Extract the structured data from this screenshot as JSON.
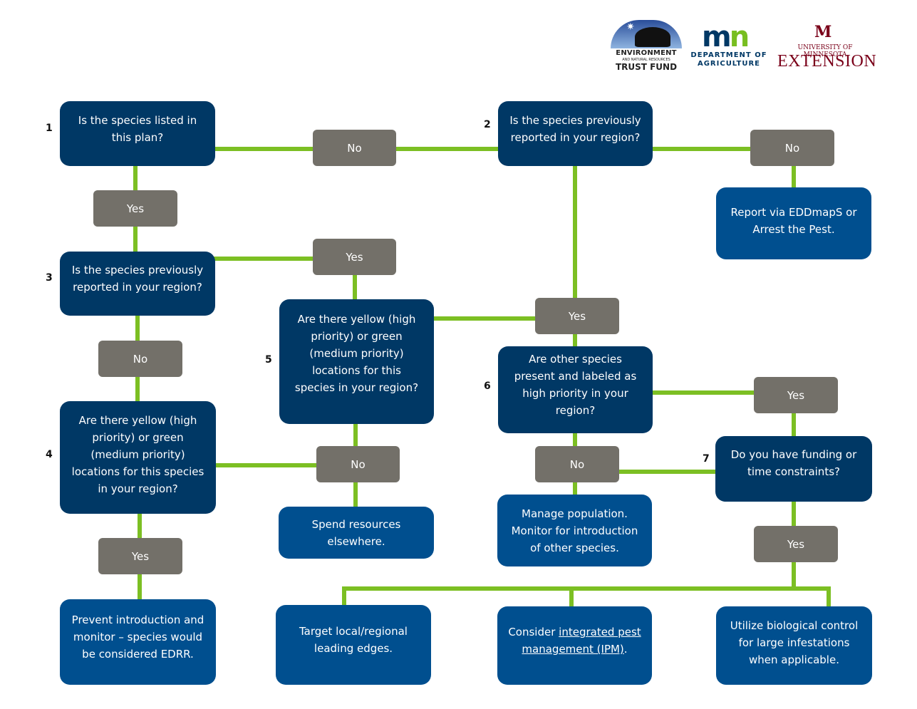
{
  "logos": {
    "trust_fund": {
      "line1": "ENVIRONMENT",
      "line2": "AND NATURAL RESOURCES",
      "line3": "TRUST FUND"
    },
    "mda": {
      "mark_m": "m",
      "mark_n": "n",
      "line1": "DEPARTMENT OF",
      "line2": "AGRICULTURE"
    },
    "umn": {
      "mark": "M",
      "line1": "UNIVERSITY OF MINNESOTA",
      "line2": "EXTENSION"
    }
  },
  "colors": {
    "question_box": "#003865",
    "action_box": "#004f8f",
    "answer_label": "#737069",
    "connector": "#7cbf23"
  },
  "steps": [
    {
      "number": "1",
      "text": "Is the species listed in this plan?"
    },
    {
      "number": "2",
      "text": "Is the species previously reported in your region?"
    },
    {
      "number": "3",
      "text": "Is the species previously reported in your region?"
    },
    {
      "number": "4",
      "text": "Are there yellow (high priority) or green (medium priority) locations for this species in your region?"
    },
    {
      "number": "5",
      "text": "Are there yellow (high priority) or green (medium priority) locations for this species in your region?"
    },
    {
      "number": "6",
      "text": "Are other species present and labeled as high priority in your region?"
    },
    {
      "number": "7",
      "text": "Do you have funding or time constraints?"
    }
  ],
  "answers": {
    "q1_no": "No",
    "q1_yes": "Yes",
    "q2_no": "No",
    "q2_yes": "Yes",
    "q3_yes": "Yes",
    "q3_no": "No",
    "q4_no": "No",
    "q4_yes": "Yes",
    "q6_yes": "Yes",
    "q6_no": "No",
    "q7_yes": "Yes"
  },
  "actions": {
    "report": "Report via EDDmapS or Arrest the Pest.",
    "spend_elsewhere": "Spend resources elsewhere.",
    "manage_population": "Manage population. Monitor for introduction of other species.",
    "prevent": "Prevent introduction and monitor – species would be considered EDRR.",
    "target_edges": "Target local/regional leading edges.",
    "ipm_prefix": "Consider ",
    "ipm_link": "integrated pest management (IPM)",
    "ipm_suffix": ".",
    "biocontrol": "Utilize biological control for large infestations when applicable."
  }
}
